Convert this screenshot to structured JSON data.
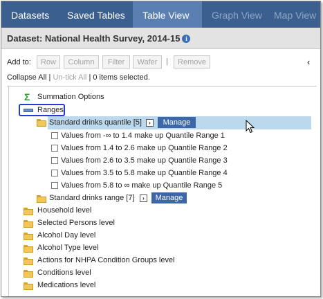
{
  "tabs": [
    {
      "label": "Datasets",
      "state": "normal"
    },
    {
      "label": "Saved Tables",
      "state": "normal"
    },
    {
      "label": "Table View",
      "state": "active"
    },
    {
      "label": "Graph View",
      "state": "disabled"
    },
    {
      "label": "Map View",
      "state": "disabled"
    }
  ],
  "dataset": {
    "title": "Dataset: National Health Survey, 2014-15",
    "info_icon": "info-icon"
  },
  "toolbar": {
    "add_to_label": "Add to:",
    "buttons": [
      "Row",
      "Column",
      "Filter",
      "Wafer",
      "Remove"
    ],
    "separator": "|",
    "collapse_icon": "chevron-left-icon"
  },
  "selection": {
    "collapse_all": "Collapse All",
    "sep": "|",
    "untick_all": "Un-tick All",
    "count_text": "0 items selected."
  },
  "tree": {
    "summation": "Summation Options",
    "ranges": "Ranges",
    "quantile": {
      "label": "Standard drinks quantile [5]",
      "expand_glyph": "›",
      "manage": "Manage"
    },
    "quantile_items": [
      "Values from -∞ to 1.4 make up Quantile Range 1",
      "Values from 1.4 to 2.6 make up Quantile Range 2",
      "Values from 2.6 to 3.5 make up Quantile Range 3",
      "Values from 3.5 to 5.8 make up Quantile Range 4",
      "Values from 5.8 to ∞ make up Quantile Range 5"
    ],
    "range": {
      "label": "Standard drinks range [7]",
      "expand_glyph": "›",
      "manage": "Manage"
    },
    "levels": [
      "Household level",
      "Selected Persons level",
      "Alcohol Day level",
      "Alcohol Type level",
      "Actions for NHPA Condition Groups level",
      "Conditions level",
      "Medications level"
    ]
  },
  "colors": {
    "tab_bar": "#3b5f8f",
    "tab_active": "#5b7fb0",
    "selected_row": "#bcd8ec",
    "manage_button": "#3c67a8",
    "highlight_box": "#1f3fd0"
  }
}
